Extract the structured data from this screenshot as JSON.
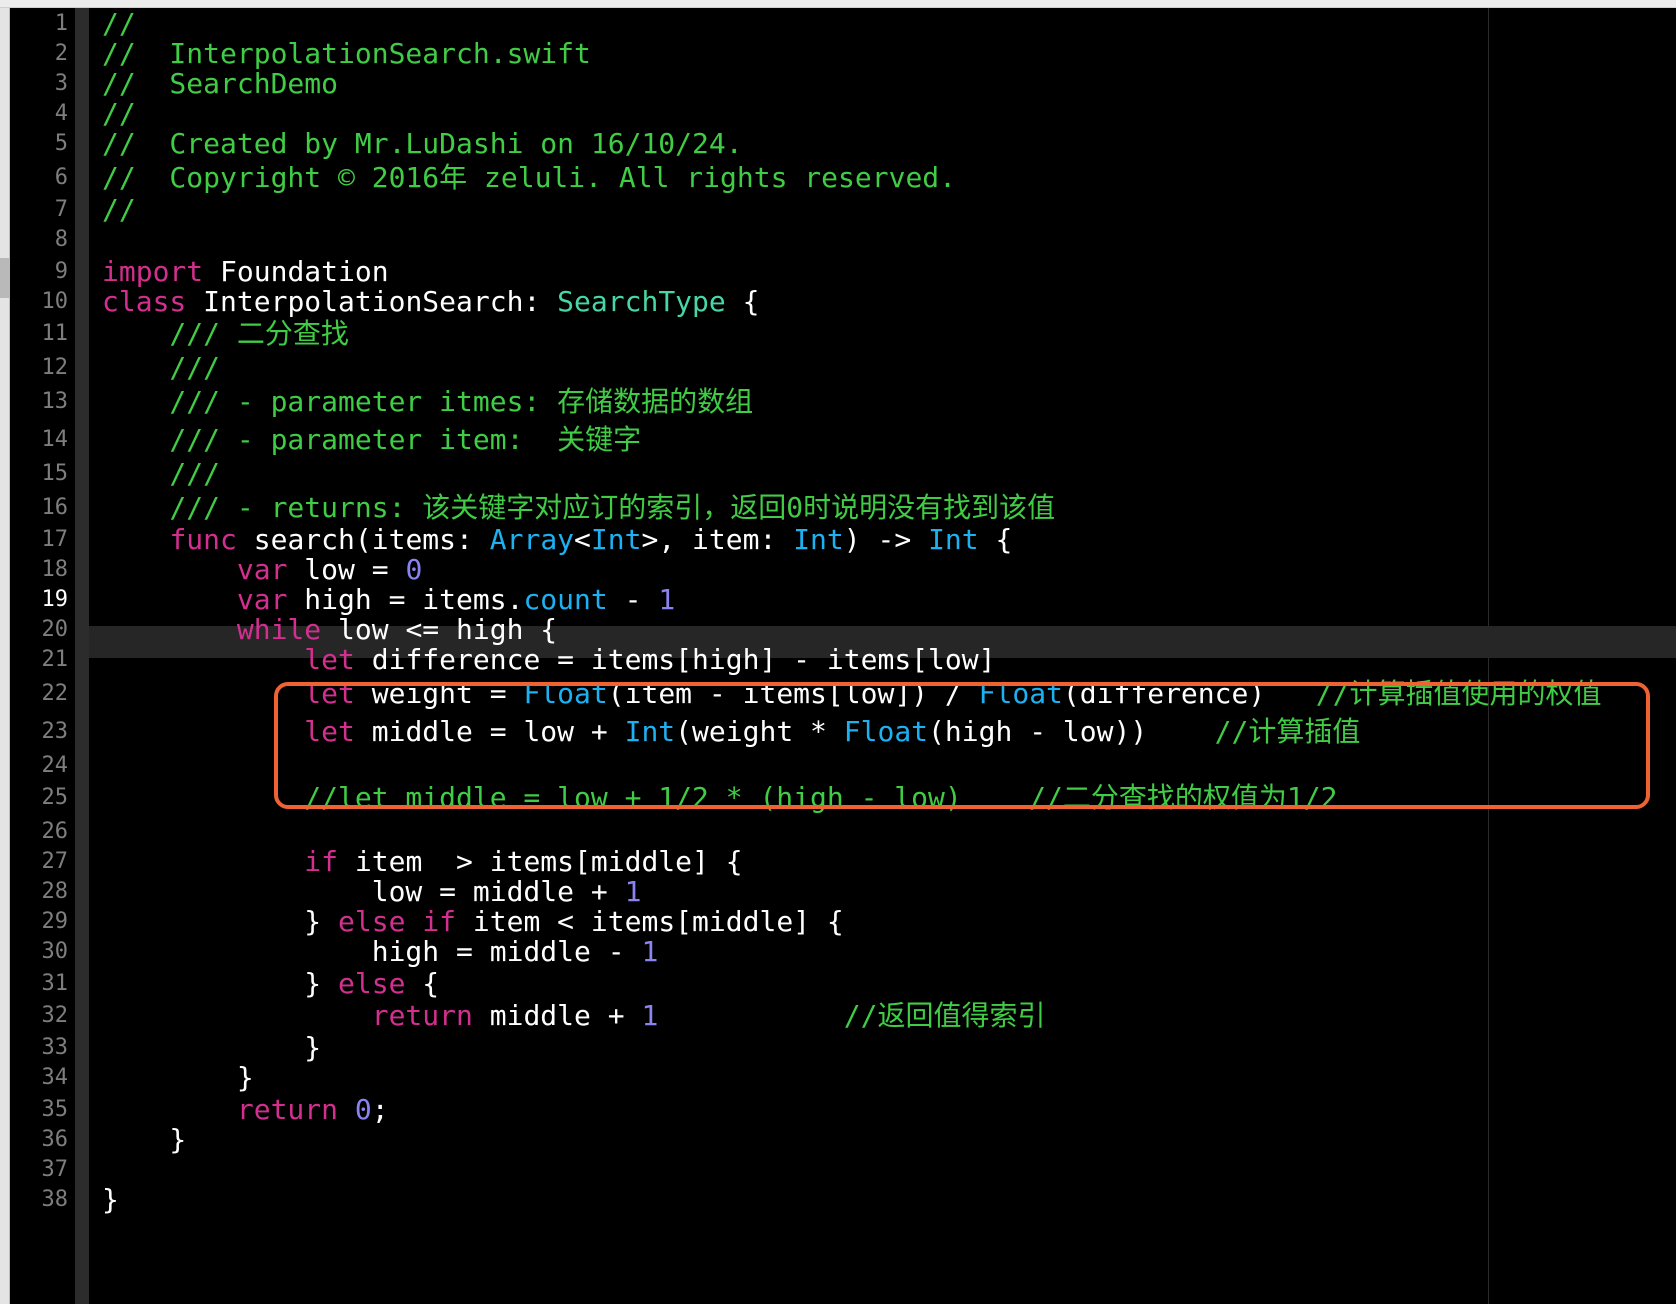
{
  "editor": {
    "accent_color": "#ef6332",
    "current_line": 19,
    "highlight": {
      "color": "#ef6332",
      "from_line": 21,
      "to_line": 23
    },
    "lines": [
      {
        "n": "1",
        "tokens": [
          {
            "t": "//",
            "k": "comment"
          }
        ]
      },
      {
        "n": "2",
        "tokens": [
          {
            "t": "//  InterpolationSearch.swift",
            "k": "comment"
          }
        ]
      },
      {
        "n": "3",
        "tokens": [
          {
            "t": "//  SearchDemo",
            "k": "comment"
          }
        ]
      },
      {
        "n": "4",
        "tokens": [
          {
            "t": "//",
            "k": "comment"
          }
        ]
      },
      {
        "n": "5",
        "tokens": [
          {
            "t": "//  Created by Mr.LuDashi on 16/10/24.",
            "k": "comment"
          }
        ]
      },
      {
        "n": "6",
        "tokens": [
          {
            "t": "//  Copyright © 2016年 zeluli. All rights reserved.",
            "k": "comment"
          }
        ]
      },
      {
        "n": "7",
        "tokens": [
          {
            "t": "//",
            "k": "comment"
          }
        ]
      },
      {
        "n": "8",
        "tokens": []
      },
      {
        "n": "9",
        "tokens": [
          {
            "t": "import",
            "k": "keyword"
          },
          {
            "t": " Foundation",
            "k": "plain"
          }
        ]
      },
      {
        "n": "10",
        "tokens": [
          {
            "t": "class",
            "k": "keyword"
          },
          {
            "t": " InterpolationSearch: ",
            "k": "plain"
          },
          {
            "t": "SearchType",
            "k": "proto"
          },
          {
            "t": " {",
            "k": "plain"
          }
        ]
      },
      {
        "n": "11",
        "tokens": [
          {
            "t": "    /// 二分查找",
            "k": "comment"
          }
        ]
      },
      {
        "n": "12",
        "tokens": [
          {
            "t": "    ///",
            "k": "comment"
          }
        ]
      },
      {
        "n": "13",
        "tokens": [
          {
            "t": "    /// - parameter itmes: 存储数据的数组",
            "k": "comment"
          }
        ]
      },
      {
        "n": "14",
        "tokens": [
          {
            "t": "    /// - parameter item:  关键字",
            "k": "comment"
          }
        ]
      },
      {
        "n": "15",
        "tokens": [
          {
            "t": "    ///",
            "k": "comment"
          }
        ]
      },
      {
        "n": "16",
        "tokens": [
          {
            "t": "    /// - returns: 该关键字对应订的索引，返回0时说明没有找到该值",
            "k": "comment"
          }
        ]
      },
      {
        "n": "17",
        "tokens": [
          {
            "t": "    ",
            "k": "plain"
          },
          {
            "t": "func",
            "k": "keyword"
          },
          {
            "t": " search(items: ",
            "k": "plain"
          },
          {
            "t": "Array",
            "k": "type"
          },
          {
            "t": "<",
            "k": "plain"
          },
          {
            "t": "Int",
            "k": "type"
          },
          {
            "t": ">, item: ",
            "k": "plain"
          },
          {
            "t": "Int",
            "k": "type"
          },
          {
            "t": ") -> ",
            "k": "plain"
          },
          {
            "t": "Int",
            "k": "type"
          },
          {
            "t": " {",
            "k": "plain"
          }
        ]
      },
      {
        "n": "18",
        "tokens": [
          {
            "t": "        ",
            "k": "plain"
          },
          {
            "t": "var",
            "k": "keyword"
          },
          {
            "t": " low = ",
            "k": "plain"
          },
          {
            "t": "0",
            "k": "number"
          }
        ]
      },
      {
        "n": "19",
        "tokens": [
          {
            "t": "        ",
            "k": "plain"
          },
          {
            "t": "var",
            "k": "keyword"
          },
          {
            "t": " high = items.",
            "k": "plain"
          },
          {
            "t": "count",
            "k": "type"
          },
          {
            "t": " - ",
            "k": "plain"
          },
          {
            "t": "1",
            "k": "number"
          }
        ]
      },
      {
        "n": "20",
        "tokens": [
          {
            "t": "        ",
            "k": "plain"
          },
          {
            "t": "while",
            "k": "keyword"
          },
          {
            "t": " low <= high {",
            "k": "plain"
          }
        ]
      },
      {
        "n": "21",
        "tokens": [
          {
            "t": "            ",
            "k": "plain"
          },
          {
            "t": "let",
            "k": "keyword"
          },
          {
            "t": " difference = items[high] - items[low]",
            "k": "plain"
          }
        ]
      },
      {
        "n": "22",
        "tokens": [
          {
            "t": "            ",
            "k": "plain"
          },
          {
            "t": "let",
            "k": "keyword"
          },
          {
            "t": " weight = ",
            "k": "plain"
          },
          {
            "t": "Float",
            "k": "type"
          },
          {
            "t": "(item - items[low]) / ",
            "k": "plain"
          },
          {
            "t": "Float",
            "k": "type"
          },
          {
            "t": "(difference)   ",
            "k": "plain"
          },
          {
            "t": "//计算插值使用的权值",
            "k": "comment"
          }
        ]
      },
      {
        "n": "23",
        "tokens": [
          {
            "t": "            ",
            "k": "plain"
          },
          {
            "t": "let",
            "k": "keyword"
          },
          {
            "t": " middle = low + ",
            "k": "plain"
          },
          {
            "t": "Int",
            "k": "type"
          },
          {
            "t": "(weight * ",
            "k": "plain"
          },
          {
            "t": "Float",
            "k": "type"
          },
          {
            "t": "(high - low))    ",
            "k": "plain"
          },
          {
            "t": "//计算插值",
            "k": "comment"
          }
        ]
      },
      {
        "n": "24",
        "tokens": []
      },
      {
        "n": "25",
        "tokens": [
          {
            "t": "            //let middle = low + 1/2 * (high - low)    //二分查找的权值为1/2",
            "k": "comment"
          }
        ]
      },
      {
        "n": "26",
        "tokens": []
      },
      {
        "n": "27",
        "tokens": [
          {
            "t": "            ",
            "k": "plain"
          },
          {
            "t": "if",
            "k": "keyword"
          },
          {
            "t": " item  > items[middle] {",
            "k": "plain"
          }
        ]
      },
      {
        "n": "28",
        "tokens": [
          {
            "t": "                low = middle + ",
            "k": "plain"
          },
          {
            "t": "1",
            "k": "number"
          }
        ]
      },
      {
        "n": "29",
        "tokens": [
          {
            "t": "            } ",
            "k": "plain"
          },
          {
            "t": "else",
            "k": "keyword"
          },
          {
            "t": " ",
            "k": "plain"
          },
          {
            "t": "if",
            "k": "keyword"
          },
          {
            "t": " item < items[middle] {",
            "k": "plain"
          }
        ]
      },
      {
        "n": "30",
        "tokens": [
          {
            "t": "                high = middle - ",
            "k": "plain"
          },
          {
            "t": "1",
            "k": "number"
          }
        ]
      },
      {
        "n": "31",
        "tokens": [
          {
            "t": "            } ",
            "k": "plain"
          },
          {
            "t": "else",
            "k": "keyword"
          },
          {
            "t": " {",
            "k": "plain"
          }
        ]
      },
      {
        "n": "32",
        "tokens": [
          {
            "t": "                ",
            "k": "plain"
          },
          {
            "t": "return",
            "k": "keyword"
          },
          {
            "t": " middle + ",
            "k": "plain"
          },
          {
            "t": "1",
            "k": "number"
          },
          {
            "t": "           ",
            "k": "plain"
          },
          {
            "t": "//返回值得索引",
            "k": "comment"
          }
        ]
      },
      {
        "n": "33",
        "tokens": [
          {
            "t": "            }",
            "k": "plain"
          }
        ]
      },
      {
        "n": "34",
        "tokens": [
          {
            "t": "        }",
            "k": "plain"
          }
        ]
      },
      {
        "n": "35",
        "tokens": [
          {
            "t": "        ",
            "k": "plain"
          },
          {
            "t": "return",
            "k": "keyword"
          },
          {
            "t": " ",
            "k": "plain"
          },
          {
            "t": "0",
            "k": "number"
          },
          {
            "t": ";",
            "k": "plain"
          }
        ]
      },
      {
        "n": "36",
        "tokens": [
          {
            "t": "    }",
            "k": "plain"
          }
        ]
      },
      {
        "n": "37",
        "tokens": []
      },
      {
        "n": "38",
        "tokens": [
          {
            "t": "}",
            "k": "plain"
          }
        ]
      }
    ]
  }
}
